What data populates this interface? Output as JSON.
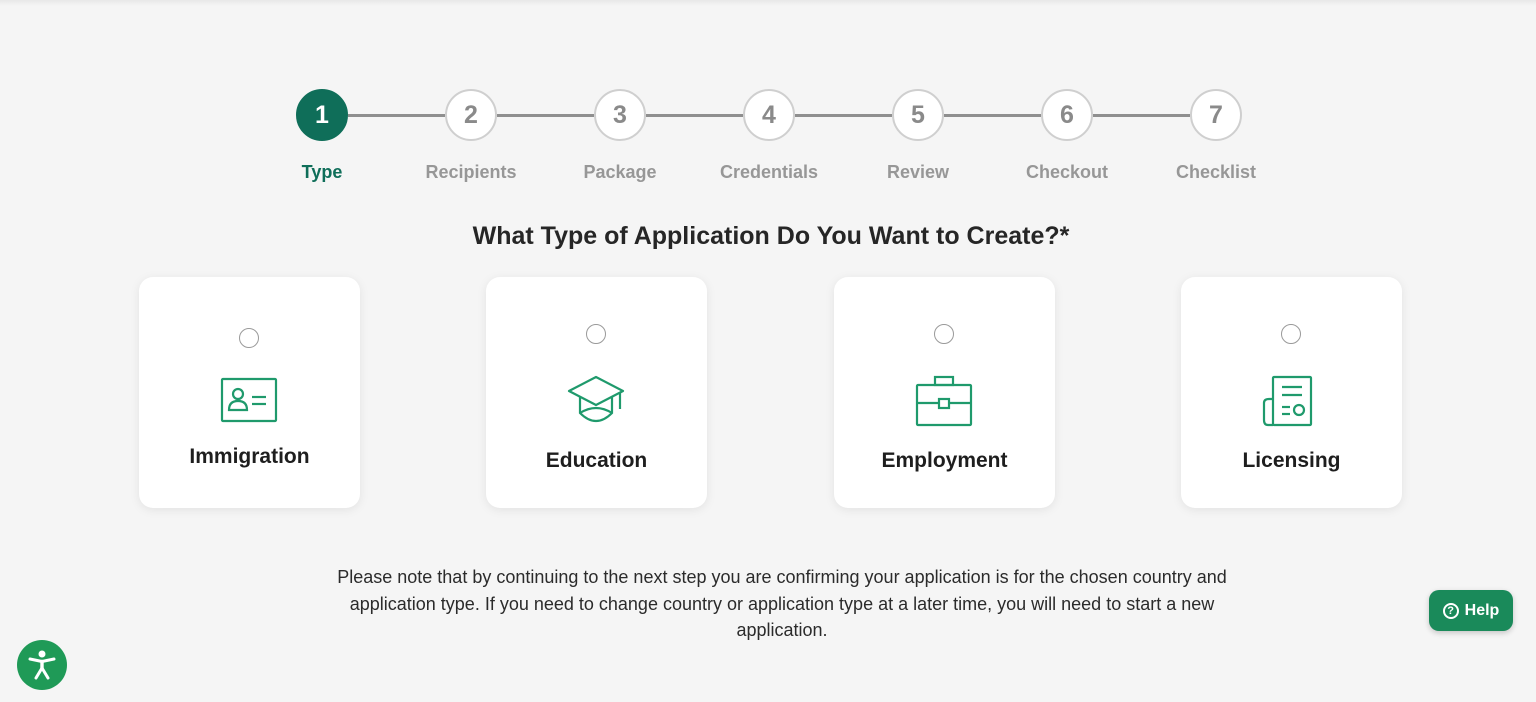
{
  "stepper": {
    "steps": [
      {
        "number": "1",
        "label": "Type",
        "active": true
      },
      {
        "number": "2",
        "label": "Recipients",
        "active": false
      },
      {
        "number": "3",
        "label": "Package",
        "active": false
      },
      {
        "number": "4",
        "label": "Credentials",
        "active": false
      },
      {
        "number": "5",
        "label": "Review",
        "active": false
      },
      {
        "number": "6",
        "label": "Checkout",
        "active": false
      },
      {
        "number": "7",
        "label": "Checklist",
        "active": false
      }
    ]
  },
  "question": "What Type of Application Do You Want to Create?*",
  "options": [
    {
      "label": "Immigration",
      "icon": "id-card-icon",
      "selected": false
    },
    {
      "label": "Education",
      "icon": "graduation-cap-icon",
      "selected": false
    },
    {
      "label": "Employment",
      "icon": "briefcase-icon",
      "selected": false
    },
    {
      "label": "Licensing",
      "icon": "license-certificate-icon",
      "selected": false
    }
  ],
  "note": "Please note that by continuing to the next step you are confirming your application is for the chosen country and application type. If you need to change country or application type at a later time, you will need to start a new application.",
  "help": {
    "label": "Help",
    "icon": "question-circle-icon"
  },
  "accessibility": {
    "icon": "accessibility-icon"
  },
  "colors": {
    "primary": "#0f6e59",
    "icon_green": "#1f9a6c",
    "help_green": "#1a8a5a",
    "accessibility_green": "#1f9a57",
    "inactive_gray": "#8a8a8a",
    "background": "#f5f5f5"
  }
}
